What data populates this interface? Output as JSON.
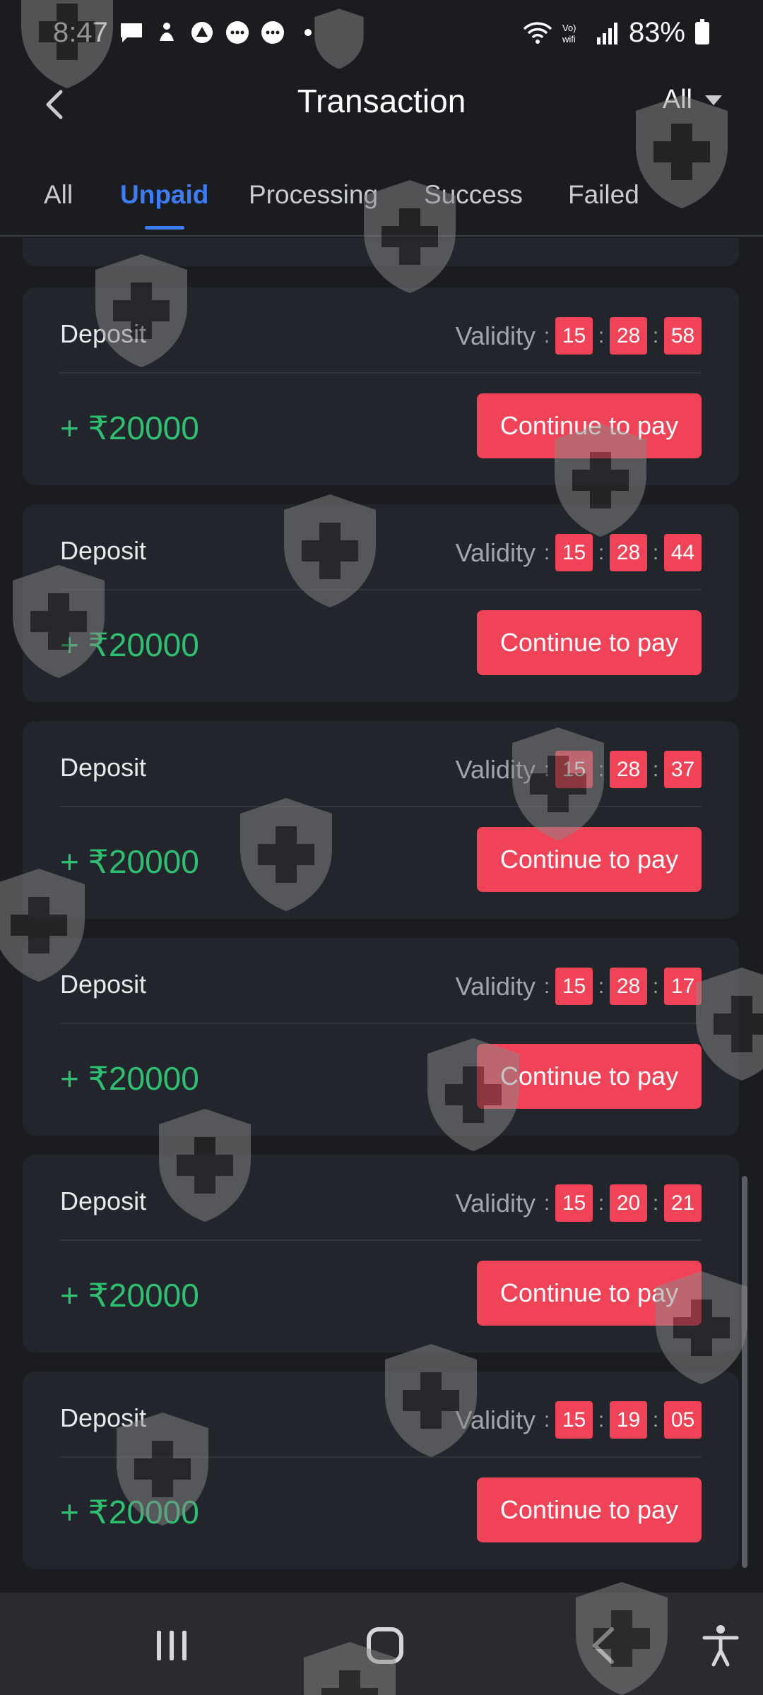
{
  "status_bar": {
    "time": "8:47",
    "battery_percent": "83%",
    "left_icons": [
      "message-icon",
      "notification-icon",
      "app-icon",
      "chat-icon",
      "chat-icon",
      "dot-icon"
    ],
    "right_icons": [
      "wifi-icon",
      "volte-wifi-icon",
      "signal-icon",
      "battery-icon"
    ]
  },
  "header": {
    "title": "Transaction",
    "filter_value": "All"
  },
  "tabs": [
    {
      "label": "All",
      "active": false
    },
    {
      "label": "Unpaid",
      "active": true
    },
    {
      "label": "Processing",
      "active": false
    },
    {
      "label": "Success",
      "active": false
    },
    {
      "label": "Failed",
      "active": false
    }
  ],
  "transactions": [
    {
      "type": "Deposit",
      "validity_label": "Validity",
      "h": "15",
      "m": "28",
      "s": "58",
      "amount": "+ ₹20000",
      "action": "Continue to pay"
    },
    {
      "type": "Deposit",
      "validity_label": "Validity",
      "h": "15",
      "m": "28",
      "s": "44",
      "amount": "+ ₹20000",
      "action": "Continue to pay"
    },
    {
      "type": "Deposit",
      "validity_label": "Validity",
      "h": "15",
      "m": "28",
      "s": "37",
      "amount": "+ ₹20000",
      "action": "Continue to pay"
    },
    {
      "type": "Deposit",
      "validity_label": "Validity",
      "h": "15",
      "m": "28",
      "s": "17",
      "amount": "+ ₹20000",
      "action": "Continue to pay"
    },
    {
      "type": "Deposit",
      "validity_label": "Validity",
      "h": "15",
      "m": "20",
      "s": "21",
      "amount": "+ ₹20000",
      "action": "Continue to pay"
    },
    {
      "type": "Deposit",
      "validity_label": "Validity",
      "h": "15",
      "m": "19",
      "s": "05",
      "amount": "+ ₹20000",
      "action": "Continue to pay"
    }
  ],
  "nav_bar": {
    "items": [
      "recent-apps-icon",
      "home-icon",
      "back-icon",
      "accessibility-icon"
    ]
  },
  "colors": {
    "background": "#1b1c20",
    "card": "#22252b",
    "accent_blue": "#3d7cf2",
    "action_red": "#f04357",
    "amount_green": "#2fbf71"
  }
}
